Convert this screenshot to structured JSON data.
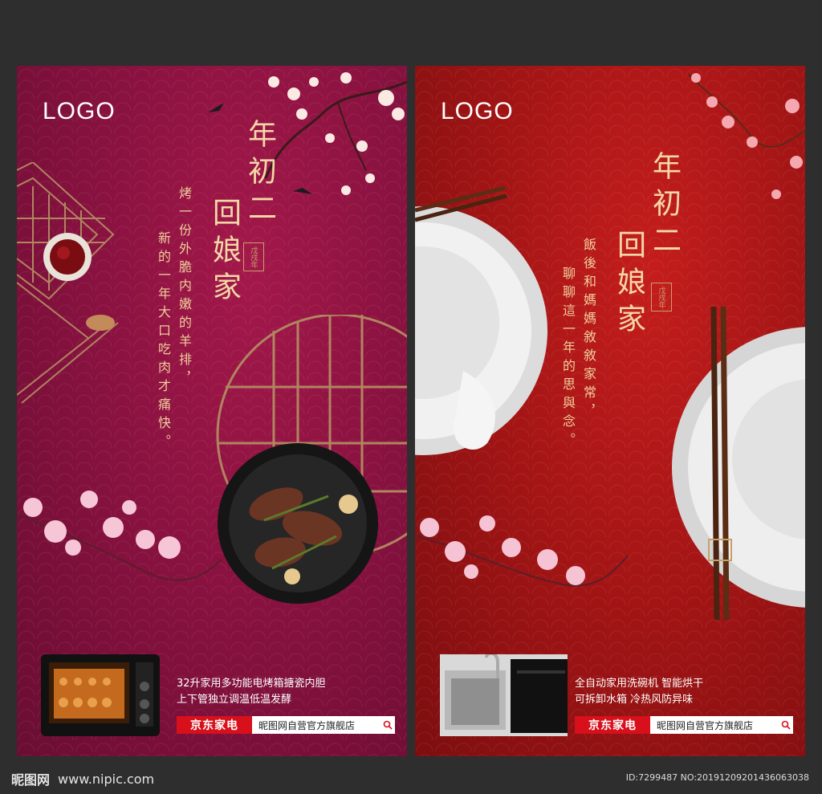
{
  "poster_left": {
    "logo": "LOGO",
    "title_col1": "年初二",
    "title_col2": "回娘家",
    "seal_text": "戊戌年",
    "desc_col1": "烤一份外脆内嫩的羊排，",
    "desc_col2": "新的一年大口吃肉才痛快。",
    "product_line1": "32升家用多功能电烤箱搪瓷内胆",
    "product_line2": "上下管独立调温低温发酵",
    "shop_brand": "京东家电",
    "shop_name": "昵图网自营官方旗舰店",
    "colors": {
      "bg": "#8a1240",
      "accent": "#f3d7a6"
    }
  },
  "poster_right": {
    "logo": "LOGO",
    "title_col1": "年初二",
    "title_col2": "回娘家",
    "seal_text": "戊戌年",
    "desc_col1": "飯後和媽媽敘敘家常，",
    "desc_col2": "聊聊這一年的思與念。",
    "product_line1": "全自动家用洗碗机  智能烘干",
    "product_line2": "可拆卸水箱  冷热风防异味",
    "shop_brand": "京东家电",
    "shop_name": "昵图网自营官方旗舰店",
    "colors": {
      "bg": "#a51515",
      "accent": "#f3d7a6"
    }
  },
  "footer": {
    "site_name": "昵图网",
    "site_url": "www.nipic.com",
    "id_text": "ID:7299487 NO:20191209201436063038"
  },
  "icons": [
    "search-icon",
    "nipic-logo-icon",
    "oven-icon",
    "dishwasher-icon"
  ]
}
